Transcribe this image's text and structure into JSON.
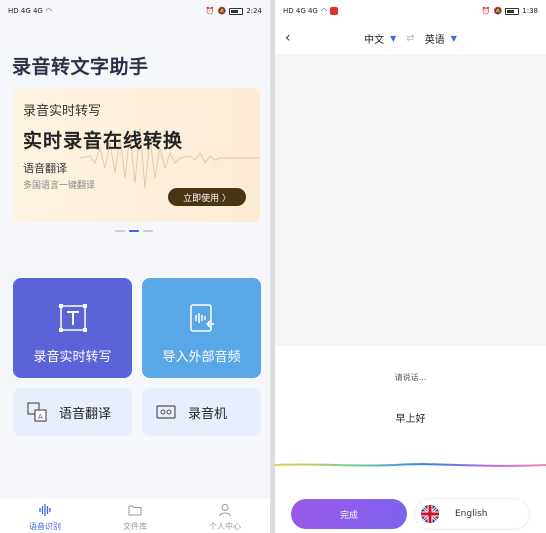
{
  "left": {
    "status": {
      "left": "HD 4G 4G",
      "time": "2:24"
    },
    "title": "录音转文字助手",
    "banner": {
      "subtitle": "录音实时转写",
      "main": "实时录音在线转换",
      "line3": "语音翻译",
      "line4": "多国语言一键翻译",
      "button": "立即使用 〉"
    },
    "cards": {
      "realtime": "录音实时转写",
      "import": "导入外部音频",
      "translate": "语音翻译",
      "recorder": "录音机"
    },
    "tabs": [
      {
        "label": "语音识别",
        "icon": "waveform-icon"
      },
      {
        "label": "文件库",
        "icon": "folder-icon"
      },
      {
        "label": "个人中心",
        "icon": "user-icon"
      }
    ]
  },
  "right": {
    "status": {
      "left": "HD 4G 4G",
      "time": "1:38"
    },
    "source_lang": "中文",
    "target_lang": "英语",
    "prompt": "请说话...",
    "result": "早上好",
    "done": "完成",
    "lang_pill": "English"
  },
  "colors": {
    "accent": "#3a68e0",
    "card_realtime": "#5a63d8",
    "card_import": "#5aa7e8",
    "done_button": "#8a5ee9"
  }
}
